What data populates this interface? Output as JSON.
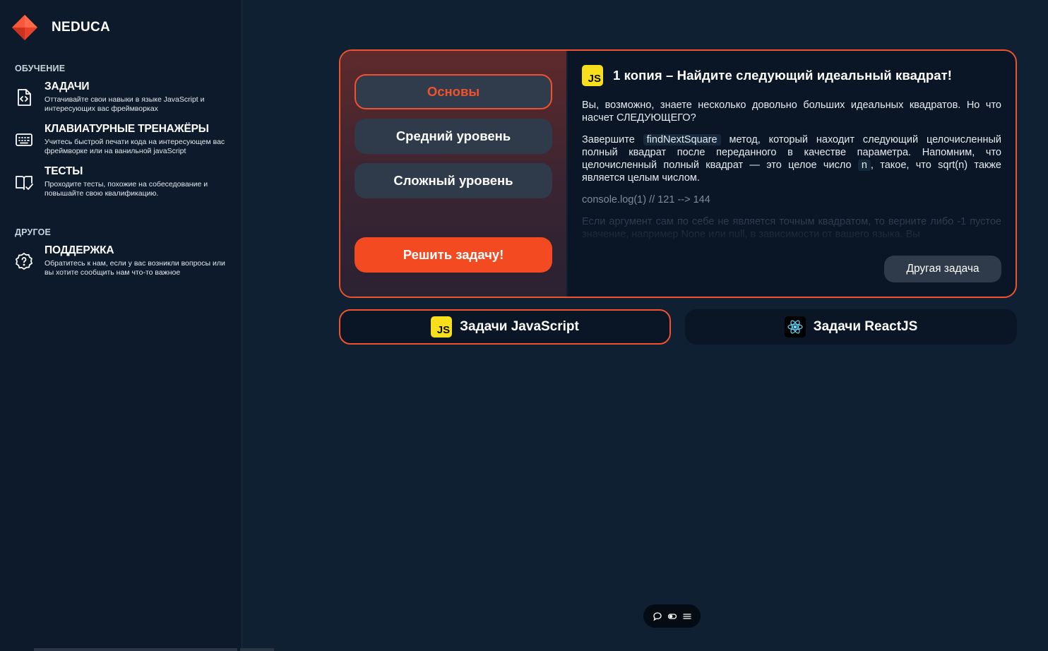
{
  "brand": {
    "name": "NEDUCA"
  },
  "sidebar": {
    "sections": [
      {
        "title": "ОБУЧЕНИЕ"
      },
      {
        "title": "ДРУГОЕ"
      }
    ],
    "items": [
      {
        "title": "ЗАДАЧИ",
        "desc": "Оттачивайте свои навыки в языке JavaScript и интересующих вас фреймворках",
        "icon": "code-file-icon"
      },
      {
        "title": "КЛАВИАТУРНЫЕ ТРЕНАЖЁРЫ",
        "desc": "Учитесь быстрой печати кода на интересующем вас фреймворке или на ванильной javaScript",
        "icon": "keyboard-icon"
      },
      {
        "title": "ТЕСТЫ",
        "desc": "Проходите тесты, похожие на собеседование и повышайте свою квалификацию.",
        "icon": "book-check-icon"
      },
      {
        "title": "ПОДДЕРЖКА",
        "desc": "Обратитесь к нам, если у вас возникли вопросы или вы хотите сообщить нам что-то важное",
        "icon": "help-circle-icon"
      }
    ]
  },
  "levels": [
    {
      "label": "Основы",
      "active": true
    },
    {
      "label": "Средний уровень",
      "active": false
    },
    {
      "label": "Сложный уровень",
      "active": false
    }
  ],
  "solve_button": "Решить задачу!",
  "task": {
    "badge": "JS",
    "title": "1 копия – Найдите следующий идеальный квадрат!",
    "p1": "Вы, возможно, знаете несколько довольно больших идеальных квадратов. Но что насчет СЛЕДУЮЩЕГО?",
    "p2_a": "Завершите ",
    "p2_code": "findNextSquare",
    "p2_b": " метод, который находит следующий целочисленный полный квадрат после переданного в качестве параметра. Напомним, что целочисленный полный квадрат — это целое число ",
    "p2_n": "n",
    "p2_c": ", такое, что ",
    "p2_sqrt": "sqrt(n)",
    "p2_d": " также является целым числом.",
    "example": "console.log(1) // 121 --> 144",
    "p3": "Если аргумент сам по себе не является точным квадратом, то верните либо -1 пустое значение, например None или null, в зависимости от вашего языка. Вы"
  },
  "other_task_button": "Другая задача",
  "tabs": [
    {
      "label": "Задачи JavaScript",
      "icon": "javascript-icon",
      "active": true
    },
    {
      "label": "Задачи ReactJS",
      "icon": "react-icon",
      "active": false
    }
  ],
  "colors": {
    "accent": "#f0522d",
    "background": "#0f2033",
    "sidebar": "#0c1a2b",
    "js_yellow": "#f7df1e"
  }
}
